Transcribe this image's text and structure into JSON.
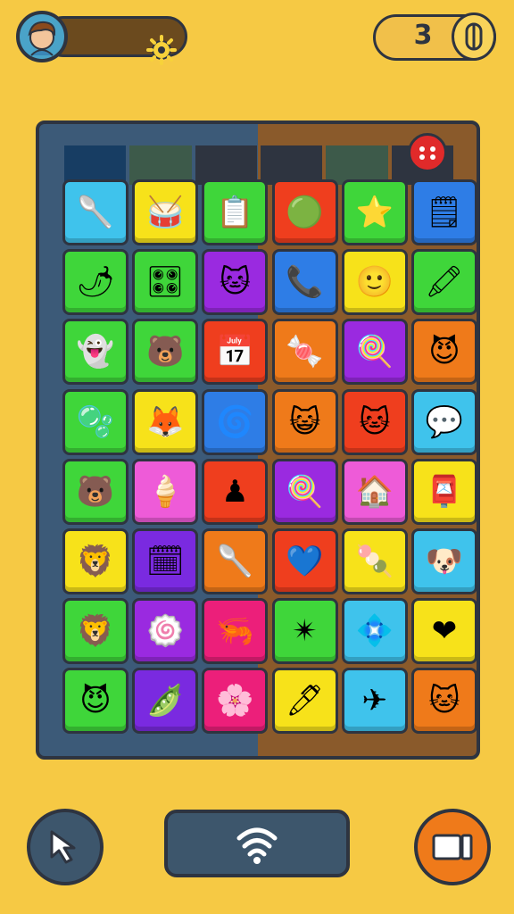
{
  "hud": {
    "coins": "3",
    "icons": {
      "avatar": "avatar-icon",
      "settings": "gear-icon",
      "coin": "coin-icon"
    }
  },
  "board": {
    "header_colors": [
      "#173d63",
      "#3d5a4a",
      "#2e3440",
      "#2e3440",
      "#3d5a4a",
      "#2e3440"
    ],
    "tiles": [
      [
        {
          "c": "#3fc3ec",
          "e": "🥄"
        },
        {
          "c": "#f7e21a",
          "e": "🥁"
        },
        {
          "c": "#3fd63a",
          "e": "📋"
        },
        {
          "c": "#ef3e1e",
          "e": "🟢"
        },
        {
          "c": "#3fd63a",
          "e": "⭐"
        },
        {
          "c": "#2e7de6",
          "e": "🗒"
        }
      ],
      [
        {
          "c": "#3fd63a",
          "e": "🌶"
        },
        {
          "c": "#3fd63a",
          "e": "🎛"
        },
        {
          "c": "#9a2ae0",
          "e": "🐱"
        },
        {
          "c": "#2e7de6",
          "e": "📞"
        },
        {
          "c": "#f7e21a",
          "e": "🙂"
        },
        {
          "c": "#3fd63a",
          "e": "🖍"
        }
      ],
      [
        {
          "c": "#3fd63a",
          "e": "👻"
        },
        {
          "c": "#3fd63a",
          "e": "🐻"
        },
        {
          "c": "#ef3e1e",
          "e": "📅"
        },
        {
          "c": "#ef7a1a",
          "e": "🍬"
        },
        {
          "c": "#9a2ae0",
          "e": "🍭"
        },
        {
          "c": "#ef7a1a",
          "e": "😈"
        }
      ],
      [
        {
          "c": "#3fd63a",
          "e": "🫧"
        },
        {
          "c": "#f7e21a",
          "e": "🦊"
        },
        {
          "c": "#2e7de6",
          "e": "🌀"
        },
        {
          "c": "#ef7a1a",
          "e": "😺"
        },
        {
          "c": "#ef3e1e",
          "e": "🐱"
        },
        {
          "c": "#3fc3ec",
          "e": "💬"
        }
      ],
      [
        {
          "c": "#3fd63a",
          "e": "🐻"
        },
        {
          "c": "#ee5bd8",
          "e": "🍦"
        },
        {
          "c": "#ef3e1e",
          "e": "♟"
        },
        {
          "c": "#9a2ae0",
          "e": "🍭"
        },
        {
          "c": "#ee5bd8",
          "e": "🏠"
        },
        {
          "c": "#f7e21a",
          "e": "📮"
        }
      ],
      [
        {
          "c": "#f7e21a",
          "e": "🦁"
        },
        {
          "c": "#7a2ae0",
          "e": "🗓"
        },
        {
          "c": "#ef7a1a",
          "e": "🥄"
        },
        {
          "c": "#ef3e1e",
          "e": "💙"
        },
        {
          "c": "#f7e21a",
          "e": "🍡"
        },
        {
          "c": "#3fc3ec",
          "e": "🐶"
        }
      ],
      [
        {
          "c": "#3fd63a",
          "e": "🦁"
        },
        {
          "c": "#9a2ae0",
          "e": "🍥"
        },
        {
          "c": "#ec1f7a",
          "e": "🦐"
        },
        {
          "c": "#3fd63a",
          "e": "✴"
        },
        {
          "c": "#3fc3ec",
          "e": "💠"
        },
        {
          "c": "#f7e21a",
          "e": "❤"
        }
      ],
      [
        {
          "c": "#3fd63a",
          "e": "😈"
        },
        {
          "c": "#7a2ae0",
          "e": "🫛"
        },
        {
          "c": "#ec1f7a",
          "e": "🌸"
        },
        {
          "c": "#f7e21a",
          "e": "🖊"
        },
        {
          "c": "#3fc3ec",
          "e": "✈"
        },
        {
          "c": "#ef7a1a",
          "e": "🐱"
        }
      ]
    ]
  },
  "controls": {
    "left_icon": "cursor-icon",
    "center_icon": "signal-icon",
    "right_icon": "stop-icon"
  }
}
